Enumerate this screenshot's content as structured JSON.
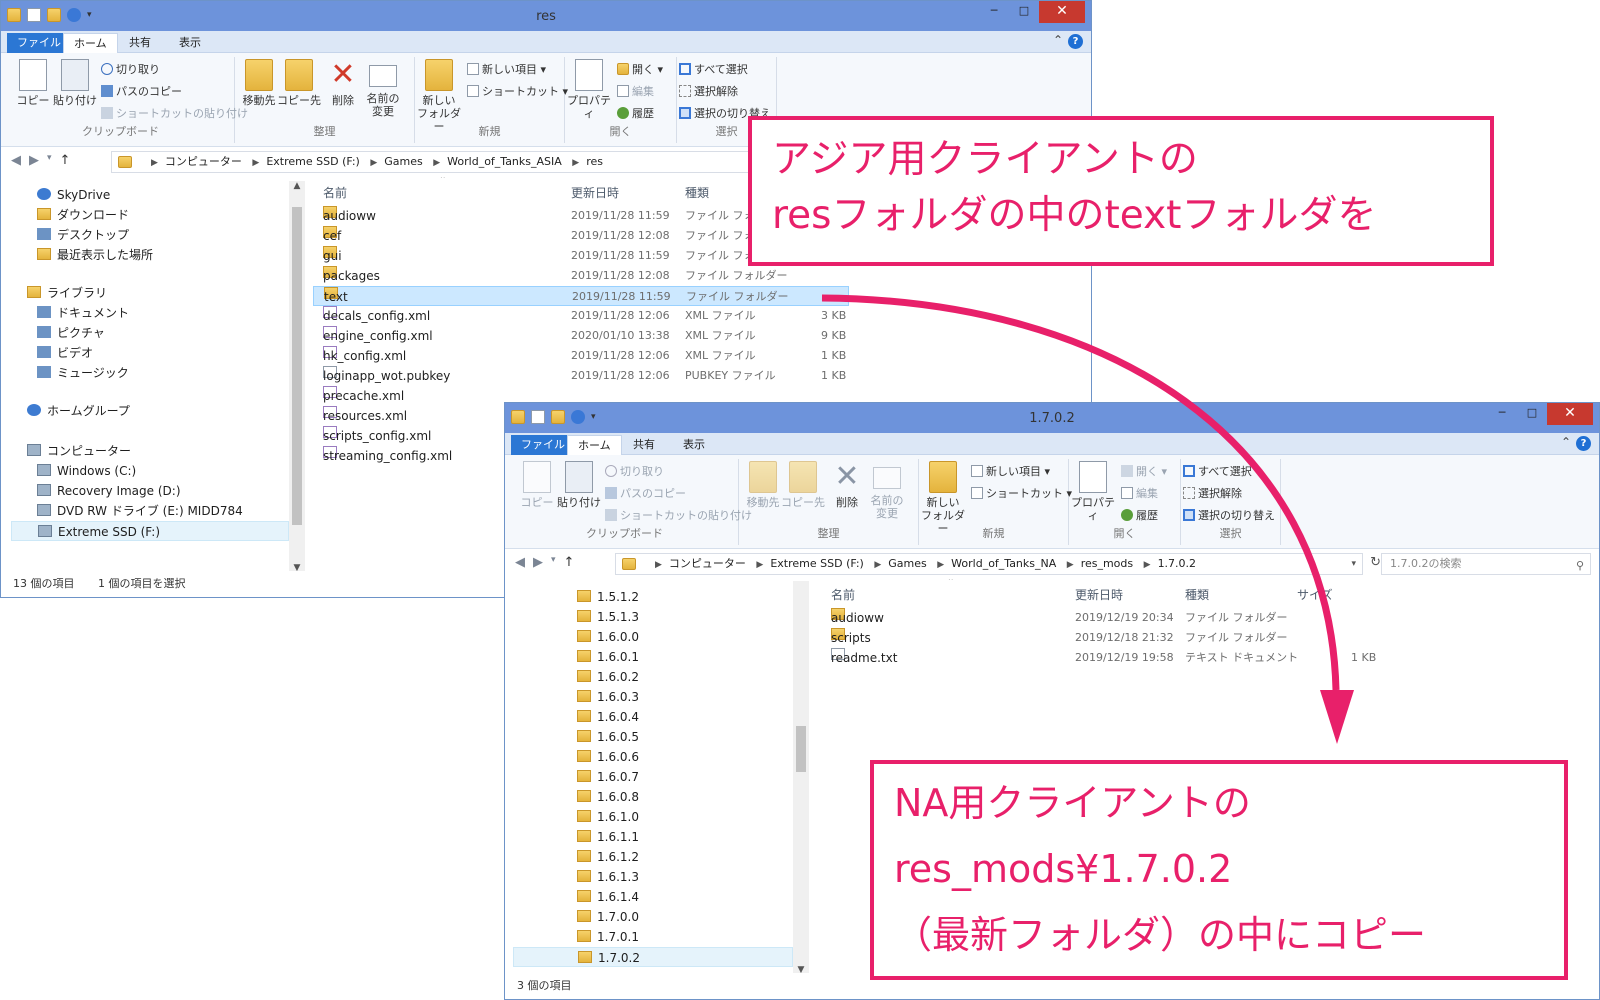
{
  "win1": {
    "title": "res",
    "tabs": [
      "ファイル",
      "ホーム",
      "共有",
      "表示"
    ],
    "ribbon": {
      "clipboard": {
        "label": "クリップボード",
        "copy": "コピー",
        "paste": "貼り付け",
        "cut": "切り取り",
        "copy_path": "パスのコピー",
        "paste_shortcut": "ショートカットの貼り付け"
      },
      "organize": {
        "label": "整理",
        "move_to": "移動先",
        "copy_to": "コピー先",
        "delete": "削除",
        "rename_1": "名前の",
        "rename_2": "変更"
      },
      "new": {
        "label": "新規",
        "new_folder_1": "新しい",
        "new_folder_2": "フォルダー",
        "new_item": "新しい項目 ▾",
        "shortcut": "ショートカット ▾"
      },
      "open": {
        "label": "開く",
        "properties": "プロパティ",
        "open": "開く ▾",
        "edit": "編集",
        "history": "履歴"
      },
      "select": {
        "label": "選択",
        "select_all": "すべて選択",
        "select_none": "選択解除",
        "invert": "選択の切り替え"
      }
    },
    "path": [
      "コンピューター",
      "Extreme SSD (F:)",
      "Games",
      "World_of_Tanks_ASIA",
      "res"
    ],
    "nav_tree": [
      {
        "label": "SkyDrive",
        "icon": "cloud-icon"
      },
      {
        "label": "ダウンロード",
        "icon": "download-icon"
      },
      {
        "label": "デスクトップ",
        "icon": "desktop-icon"
      },
      {
        "label": "最近表示した場所",
        "icon": "recent-icon"
      },
      {
        "label": "ライブラリ",
        "icon": "library-icon"
      },
      {
        "label": "ドキュメント",
        "icon": "document-icon"
      },
      {
        "label": "ピクチャ",
        "icon": "picture-icon"
      },
      {
        "label": "ビデオ",
        "icon": "video-icon"
      },
      {
        "label": "ミュージック",
        "icon": "music-icon"
      },
      {
        "label": "ホームグループ",
        "icon": "homegroup-icon"
      },
      {
        "label": "コンピューター",
        "icon": "computer-icon"
      },
      {
        "label": "Windows (C:)",
        "icon": "drive-icon"
      },
      {
        "label": "Recovery Image (D:)",
        "icon": "drive-icon"
      },
      {
        "label": "DVD RW ドライブ (E:) MIDD784",
        "icon": "dvd-icon"
      },
      {
        "label": "Extreme SSD (F:)",
        "icon": "drive-icon"
      }
    ],
    "columns": [
      "名前",
      "更新日時",
      "種類"
    ],
    "files": [
      {
        "name": "audioww",
        "date": "2019/11/28 11:59",
        "type": "ファイル フォル",
        "size": "",
        "icon": "folder-icon"
      },
      {
        "name": "cef",
        "date": "2019/11/28 12:08",
        "type": "ファイル フォル",
        "size": "",
        "icon": "folder-icon"
      },
      {
        "name": "gui",
        "date": "2019/11/28 11:59",
        "type": "ファイル フォル",
        "size": "",
        "icon": "folder-icon"
      },
      {
        "name": "packages",
        "date": "2019/11/28 12:08",
        "type": "ファイル フォルダー",
        "size": "",
        "icon": "folder-icon"
      },
      {
        "name": "text",
        "date": "2019/11/28 11:59",
        "type": "ファイル フォルダー",
        "size": "",
        "icon": "folder-icon"
      },
      {
        "name": "decals_config.xml",
        "date": "2019/11/28 12:06",
        "type": "XML ファイル",
        "size": "3 KB",
        "icon": "xml-file-icon"
      },
      {
        "name": "engine_config.xml",
        "date": "2020/01/10 13:38",
        "type": "XML ファイル",
        "size": "9 KB",
        "icon": "xml-file-icon"
      },
      {
        "name": "hk_config.xml",
        "date": "2019/11/28 12:06",
        "type": "XML ファイル",
        "size": "1 KB",
        "icon": "xml-file-icon"
      },
      {
        "name": "loginapp_wot.pubkey",
        "date": "2019/11/28 12:06",
        "type": "PUBKEY ファイル",
        "size": "1 KB",
        "icon": "file-icon"
      },
      {
        "name": "precache.xml",
        "date": "",
        "type": "",
        "size": "",
        "icon": "xml-file-icon"
      },
      {
        "name": "resources.xml",
        "date": "",
        "type": "",
        "size": "",
        "icon": "xml-file-icon"
      },
      {
        "name": "scripts_config.xml",
        "date": "",
        "type": "",
        "size": "",
        "icon": "xml-file-icon"
      },
      {
        "name": "streaming_config.xml",
        "date": "",
        "type": "",
        "size": "",
        "icon": "xml-file-icon"
      }
    ],
    "status": {
      "count": "13 個の項目",
      "selected": "1 個の項目を選択"
    }
  },
  "win2": {
    "title": "1.7.0.2",
    "tabs": [
      "ファイル",
      "ホーム",
      "共有",
      "表示"
    ],
    "path": [
      "コンピューター",
      "Extreme SSD (F:)",
      "Games",
      "World_of_Tanks_NA",
      "res_mods",
      "1.7.0.2"
    ],
    "search_placeholder": "1.7.0.2の検索",
    "tree": [
      "1.5.1.2",
      "1.5.1.3",
      "1.6.0.0",
      "1.6.0.1",
      "1.6.0.2",
      "1.6.0.3",
      "1.6.0.4",
      "1.6.0.5",
      "1.6.0.6",
      "1.6.0.7",
      "1.6.0.8",
      "1.6.1.0",
      "1.6.1.1",
      "1.6.1.2",
      "1.6.1.3",
      "1.6.1.4",
      "1.7.0.0",
      "1.7.0.1",
      "1.7.0.2"
    ],
    "columns": [
      "名前",
      "更新日時",
      "種類",
      "サイズ"
    ],
    "files": [
      {
        "name": "audioww",
        "date": "2019/12/19 20:34",
        "type": "ファイル フォルダー",
        "size": "",
        "icon": "folder-icon"
      },
      {
        "name": "scripts",
        "date": "2019/12/18 21:32",
        "type": "ファイル フォルダー",
        "size": "",
        "icon": "folder-icon"
      },
      {
        "name": "readme.txt",
        "date": "2019/12/19 19:58",
        "type": "テキスト ドキュメント",
        "size": "1 KB",
        "icon": "text-file-icon"
      }
    ],
    "status": {
      "count": "3 個の項目"
    }
  },
  "callouts": {
    "top": {
      "line1": "アジア用クライアントの",
      "line2": "resフォルダの中のtextフォルダを"
    },
    "bottom": {
      "line1": "NA用クライアントの",
      "line2": "res_mods¥1.7.0.2",
      "line3": "（最新フォルダ）の中にコピー"
    }
  },
  "colors": {
    "accent": "#e8206a",
    "titlebar": "#6d93db",
    "file_tab": "#2b77d4",
    "close": "#c7392f"
  }
}
